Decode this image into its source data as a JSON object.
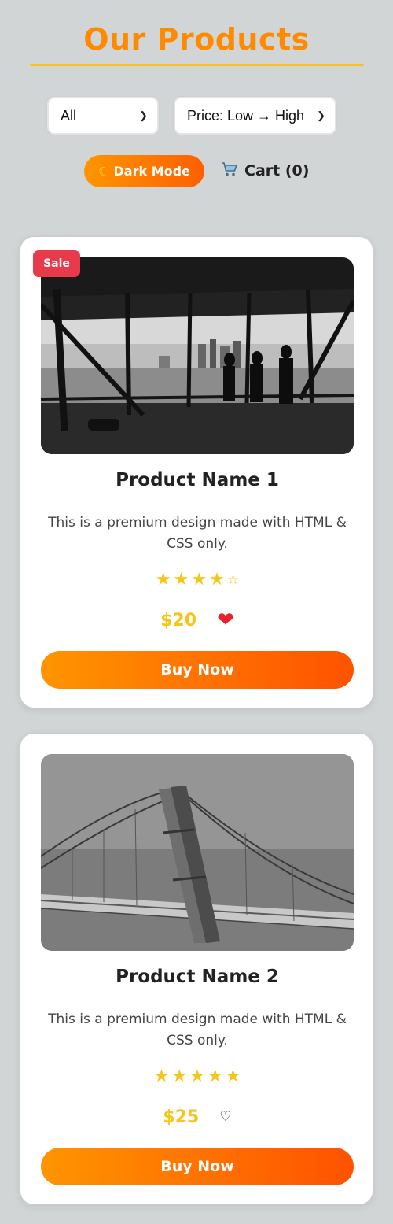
{
  "header": {
    "title": "Our Products"
  },
  "filters": {
    "category_value": "All",
    "sort_value": "Price: Low → High"
  },
  "toolbar": {
    "dark_mode_icon": "moon-icon",
    "dark_mode_label": "Dark Mode",
    "cart_icon": "cart-icon",
    "cart_label": "Cart (0)"
  },
  "colors": {
    "accent": "#ff8a00",
    "underline": "#f5c518",
    "sale": "#e83a4b",
    "price": "#f5c518",
    "heart": "#e8222c"
  },
  "products": [
    {
      "badge": "Sale",
      "image": "office-city-view-photo",
      "name": "Product Name 1",
      "description": "This is a premium design made with HTML & CSS only.",
      "rating": 4,
      "rating_max": 5,
      "price": "$20",
      "favorite": true,
      "buy_label": "Buy Now"
    },
    {
      "badge": "",
      "image": "suspension-bridge-aerial-photo",
      "name": "Product Name 2",
      "description": "This is a premium design made with HTML & CSS only.",
      "rating": 5,
      "rating_max": 5,
      "price": "$25",
      "favorite": false,
      "buy_label": "Buy Now"
    }
  ]
}
